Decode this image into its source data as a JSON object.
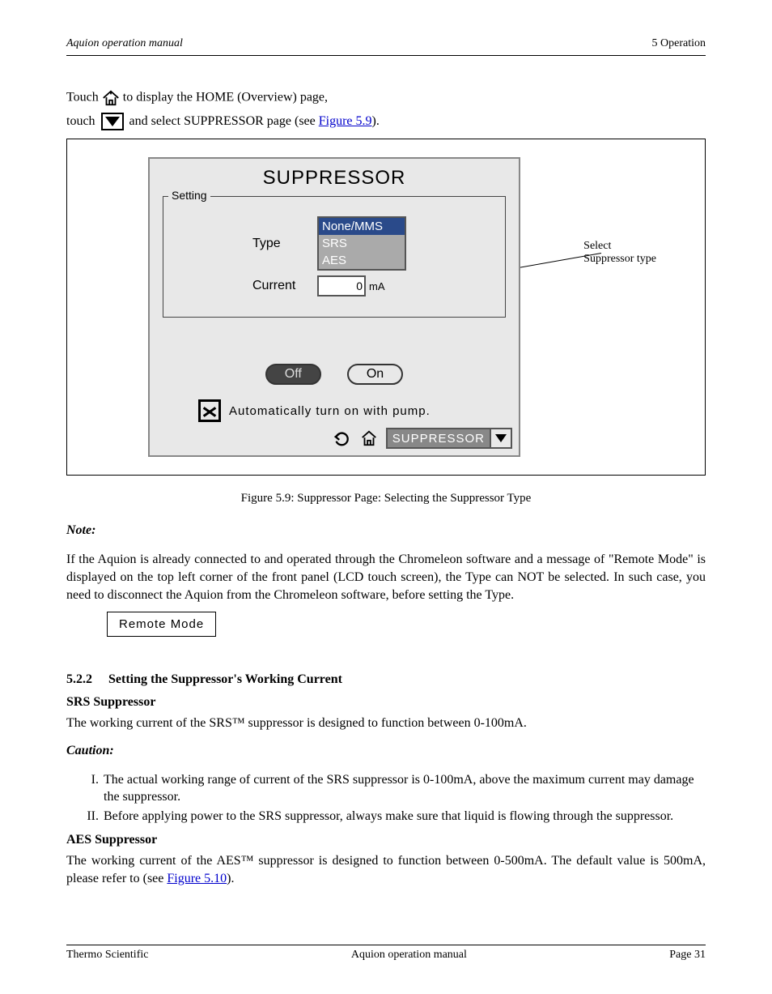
{
  "header": {
    "left": "Aquion operation manual",
    "right": "5 Operation"
  },
  "intro": {
    "line1a": "Touch ",
    "line1b": " to display the HOME (Overview) page,",
    "line2a": "touch ",
    "line2b": " and select SUPPRESSOR page (see ",
    "line2link": "Figure 5.9",
    "line2c": ")."
  },
  "figure": {
    "sideLabel1": "Select",
    "sideLabel2": "Suppressor type",
    "dialog": {
      "title": "SUPPRESSOR",
      "fieldsetLegend": "Setting",
      "typeLabel": "Type",
      "typeOptions": [
        "None/MMS",
        "SRS",
        "AES"
      ],
      "currentLabel": "Current",
      "currentValue": "0",
      "currentUnit": "mA",
      "offLabel": "Off",
      "onLabel": "On",
      "checkboxLabel": "Automatically turn on with pump.",
      "dropdownValue": "SUPPRESSOR"
    },
    "caption": "Figure 5.9: Suppressor Page: Selecting the Suppressor Type"
  },
  "note": {
    "title": "Note:",
    "body": "If the Aquion is already connected to and operated through the Chromeleon software and a message of \"Remote Mode\" is displayed on the top left corner of the front panel (LCD touch screen), the Type can NOT be selected. In such case, you need to disconnect the Aquion from the Chromeleon software, before setting the Type."
  },
  "remoteModeLabel": "Remote  Mode",
  "section": {
    "num": "5.2.2",
    "title": "Setting the Suppressor's Working Current",
    "sub1": "SRS Suppressor",
    "sub1_body": "The working current of the SRS™ suppressor is designed to function between 0-100mA.",
    "caution1_title": "Caution:",
    "caution1_list": [
      "The actual working range of current of the SRS suppressor is 0-100mA, above the maximum current may damage the suppressor.",
      "Before applying power to the SRS suppressor, always make sure that liquid is flowing through the suppressor."
    ],
    "sub2": "AES Suppressor",
    "sub2_body_a": "The working current of the AES™ suppressor is designed to function between 0-500mA. The default value is 500mA, please refer to (see ",
    "sub2_link": "Figure 5.10",
    "sub2_body_b": ")."
  },
  "footer": {
    "left": "Thermo Scientific",
    "center": "Aquion operation manual",
    "right": "Page 31"
  }
}
